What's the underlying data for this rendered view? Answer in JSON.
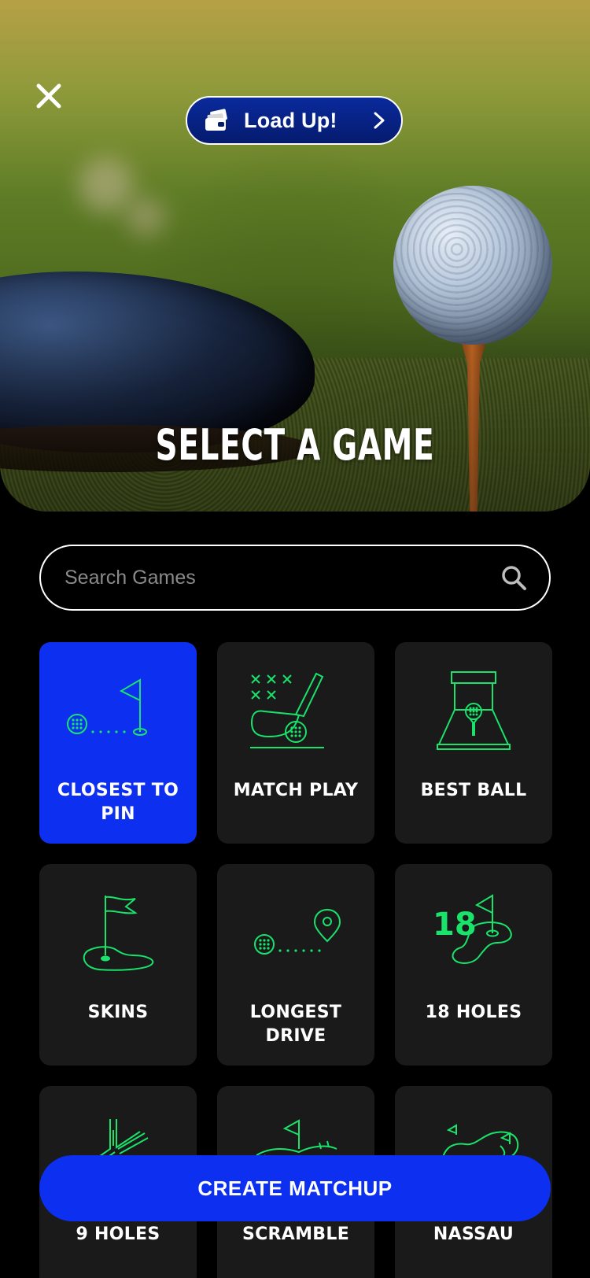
{
  "header": {
    "close_icon": "close-icon",
    "load_up": {
      "label": "Load Up!",
      "icon": "wallet-card-icon",
      "chevron": "chevron-right-icon"
    },
    "title": "SELECT A GAME"
  },
  "search": {
    "placeholder": "Search Games",
    "value": "",
    "icon": "search-icon"
  },
  "games": [
    {
      "label": "CLOSEST TO PIN",
      "icon": "ball-to-flag-icon",
      "selected": true
    },
    {
      "label": "MATCH PLAY",
      "icon": "club-and-ball-icon",
      "selected": false
    },
    {
      "label": "BEST BALL",
      "icon": "ball-on-tee-frame-icon",
      "selected": false
    },
    {
      "label": "SKINS",
      "icon": "flag-on-green-icon",
      "selected": false
    },
    {
      "label": "LONGEST DRIVE",
      "icon": "ball-to-pin-marker-icon",
      "selected": false
    },
    {
      "label": "18 HOLES",
      "icon": "eighteen-holes-icon",
      "selected": false
    },
    {
      "label": "9 HOLES",
      "icon": "fairway-icon",
      "selected": false
    },
    {
      "label": "SCRAMBLE",
      "icon": "scramble-icon",
      "selected": false
    },
    {
      "label": "NASSAU",
      "icon": "course-layout-icon",
      "selected": false
    }
  ],
  "cta": {
    "label": "CREATE MATCHUP"
  },
  "colors": {
    "accent": "#0d2ff0",
    "icon_green": "#19e36b",
    "card_bg": "#1a1a1a",
    "load_up_bg": "#051b6e"
  }
}
